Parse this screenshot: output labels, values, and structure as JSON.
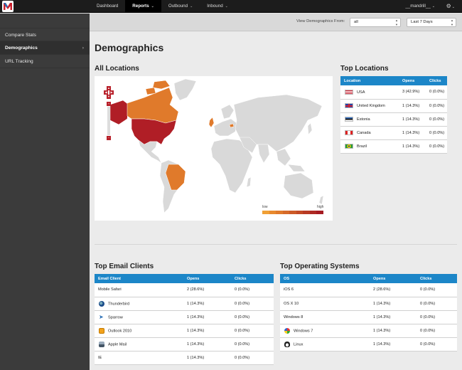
{
  "nav": {
    "items": [
      {
        "label": "Dashboard",
        "caret": ""
      },
      {
        "label": "Reports",
        "caret": "⌄"
      },
      {
        "label": "Outbound",
        "caret": "⌄"
      },
      {
        "label": "Inbound",
        "caret": "⌄"
      }
    ],
    "active": "Reports",
    "user": "__mandrill__",
    "user_caret": "⌄",
    "settings_icon": "gear-icon",
    "settings_caret": "⌄"
  },
  "sidebar": {
    "items": [
      {
        "label": "Compare Stats"
      },
      {
        "label": "Demographics",
        "chevron": "›"
      },
      {
        "label": "URL Tracking"
      }
    ]
  },
  "filter": {
    "label": "View Demographics From:",
    "source_value": "all",
    "range_value": "Last 7 Days",
    "arrows": "▲▼"
  },
  "page": {
    "title": "Demographics",
    "all_locations": "All Locations",
    "top_locations": "Top Locations",
    "top_email_clients": "Top Email Clients",
    "top_os": "Top Operating Systems"
  },
  "map": {
    "legend_low": "low",
    "legend_high": "high",
    "legend_colors": [
      "#f0a035",
      "#e8892e",
      "#e07a2b",
      "#d66a29",
      "#cc5a27",
      "#c24a25",
      "#b83a24",
      "#ae2a23",
      "#a51b22"
    ],
    "colors": {
      "usa": "#b01e26",
      "other": "#e07a2b",
      "base": "#d9d9d9"
    },
    "zoom_controls": [
      "zoom-in",
      "zoom-out",
      "pan-up",
      "pan-left",
      "pan-right",
      "pan-down"
    ]
  },
  "top_locations": {
    "headers": [
      "Location",
      "Opens",
      "Clicks"
    ],
    "rows": [
      {
        "location": "USA",
        "opens": "3 (42.9%)",
        "clicks": "0 (0.0%)"
      },
      {
        "location": "United Kingdom",
        "opens": "1 (14.3%)",
        "clicks": "0 (0.0%)"
      },
      {
        "location": "Estonia",
        "opens": "1 (14.3%)",
        "clicks": "0 (0.0%)"
      },
      {
        "location": "Canada",
        "opens": "1 (14.3%)",
        "clicks": "0 (0.0%)"
      },
      {
        "location": "Brazil",
        "opens": "1 (14.3%)",
        "clicks": "0 (0.0%)"
      }
    ]
  },
  "email_clients": {
    "headers": [
      "Email Client",
      "Opens",
      "Clicks"
    ],
    "rows": [
      {
        "name": "Mobile Safari",
        "icon": "",
        "opens": "2 (28.6%)",
        "clicks": "0 (0.0%)"
      },
      {
        "name": "Thunderbird",
        "icon": "thunderbird-icon",
        "opens": "1 (14.3%)",
        "clicks": "0 (0.0%)"
      },
      {
        "name": "Sparrow",
        "icon": "sparrow-icon",
        "opens": "1 (14.3%)",
        "clicks": "0 (0.0%)"
      },
      {
        "name": "Outlook 2010",
        "icon": "outlook-icon",
        "opens": "1 (14.3%)",
        "clicks": "0 (0.0%)"
      },
      {
        "name": "Apple Mail",
        "icon": "apple-mail-icon",
        "opens": "1 (14.3%)",
        "clicks": "0 (0.0%)"
      },
      {
        "name": "IE",
        "icon": "",
        "opens": "1 (14.3%)",
        "clicks": "0 (0.0%)"
      }
    ]
  },
  "os": {
    "headers": [
      "OS",
      "Opens",
      "Clicks"
    ],
    "rows": [
      {
        "name": "iOS 6",
        "icon": "",
        "opens": "2 (28.6%)",
        "clicks": "0 (0.0%)"
      },
      {
        "name": "OS X 10",
        "icon": "",
        "opens": "1 (14.3%)",
        "clicks": "0 (0.0%)"
      },
      {
        "name": "Windows 8",
        "icon": "",
        "opens": "1 (14.3%)",
        "clicks": "0 (0.0%)"
      },
      {
        "name": "Windows 7",
        "icon": "windows-icon",
        "opens": "1 (14.3%)",
        "clicks": "0 (0.0%)"
      },
      {
        "name": "Linux",
        "icon": "linux-icon",
        "opens": "1 (14.3%)",
        "clicks": "0 (0.0%)"
      }
    ]
  }
}
